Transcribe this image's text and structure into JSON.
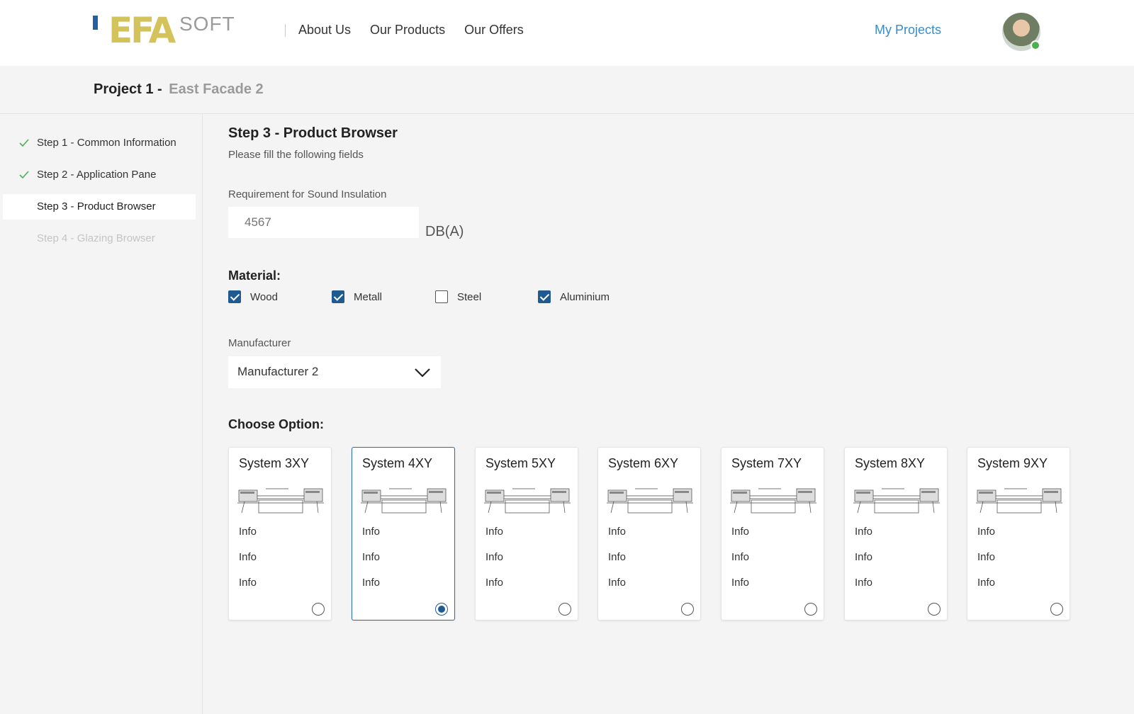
{
  "brand": {
    "logo_main": "EFA",
    "logo_sub": "SOFT",
    "logo_color": "#d4c25a",
    "accent": "#2360a0"
  },
  "nav": {
    "items": [
      {
        "label": "About Us"
      },
      {
        "label": "Our Products"
      },
      {
        "label": "Our Offers"
      }
    ],
    "my_projects": "My Projects",
    "avatar_icon": "user-avatar-icon",
    "status": "online"
  },
  "project": {
    "title": "Project 1 -",
    "subtitle": "East Facade 2"
  },
  "steps": [
    {
      "label": "Step 1 - Common Information",
      "state": "done",
      "icon": "check-icon"
    },
    {
      "label": "Step 2 - Application Pane",
      "state": "done",
      "icon": "check-icon"
    },
    {
      "label": "Step 3 - Product Browser",
      "state": "active"
    },
    {
      "label": "Step 4 - Glazing Browser",
      "state": "disabled"
    }
  ],
  "main": {
    "heading": "Step 3 - Product Browser",
    "subheading": "Please fill the following fields",
    "sound": {
      "label": "Requirement for Sound Insulation",
      "value": "",
      "placeholder": "4567",
      "unit": "DB(A)"
    },
    "material": {
      "label": "Material:",
      "options": [
        {
          "label": "Wood",
          "checked": true
        },
        {
          "label": "Metall",
          "checked": true
        },
        {
          "label": "Steel",
          "checked": false
        },
        {
          "label": "Aluminium",
          "checked": true
        }
      ]
    },
    "manufacturer": {
      "label": "Manufacturer",
      "selected": "Manufacturer 2",
      "icon": "chevron-down-icon"
    },
    "choose": {
      "label": "Choose Option:",
      "options": [
        {
          "title": "System 3XY",
          "info": [
            "Info",
            "Info",
            "Info"
          ],
          "selected": false
        },
        {
          "title": "System 4XY",
          "info": [
            "Info",
            "Info",
            "Info"
          ],
          "selected": true
        },
        {
          "title": "System 5XY",
          "info": [
            "Info",
            "Info",
            "Info"
          ],
          "selected": false
        },
        {
          "title": "System 6XY",
          "info": [
            "Info",
            "Info",
            "Info"
          ],
          "selected": false
        },
        {
          "title": "System 7XY",
          "info": [
            "Info",
            "Info",
            "Info"
          ],
          "selected": false
        },
        {
          "title": "System 8XY",
          "info": [
            "Info",
            "Info",
            "Info"
          ],
          "selected": false
        },
        {
          "title": "System 9XY",
          "info": [
            "Info",
            "Info",
            "Info"
          ],
          "selected": false
        }
      ]
    }
  }
}
